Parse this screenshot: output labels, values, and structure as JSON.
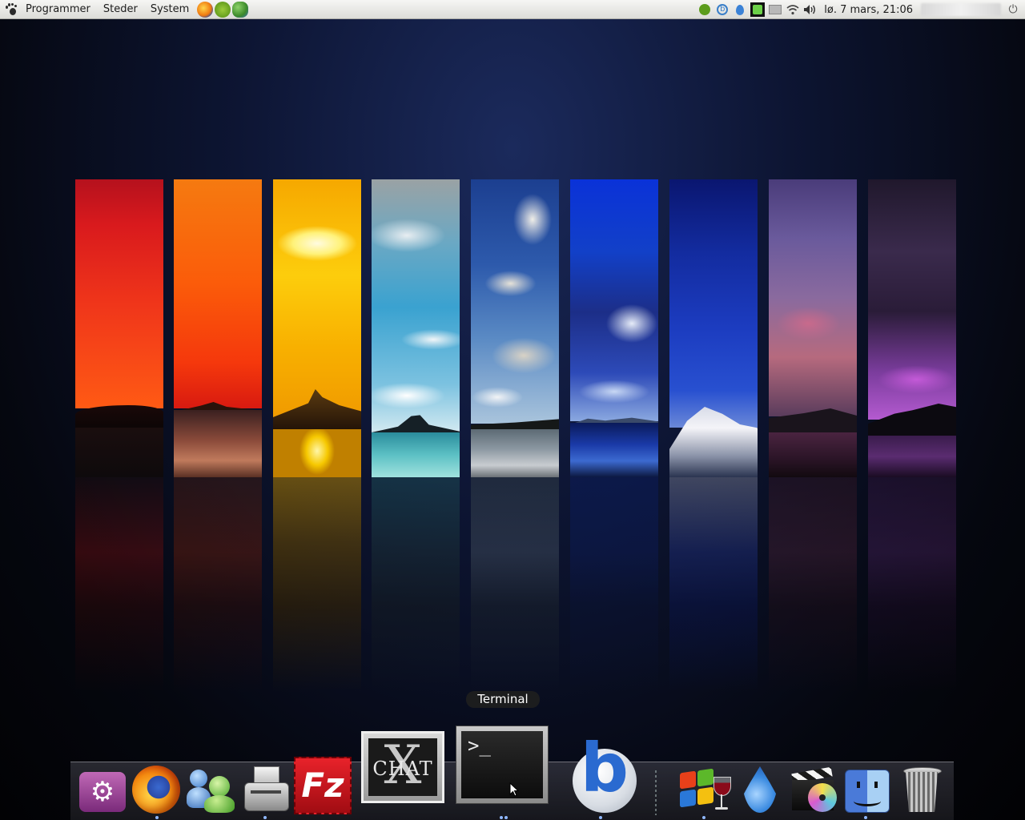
{
  "panel": {
    "menus": [
      "Programmer",
      "Steder",
      "System"
    ],
    "clock": "lø. 7 mars, 21:06",
    "launchers": [
      "firefox-icon",
      "spotify-icon",
      "pidgin-icon"
    ],
    "tray": [
      "spotify-tray-icon",
      "songbird-tray-icon",
      "drop-tray-icon",
      "chat-tray-icon",
      "printer-tray-icon",
      "wifi-icon",
      "volume-icon"
    ]
  },
  "dock": {
    "tooltip": "Terminal",
    "items": [
      {
        "name": "settings",
        "icon": "gear-icon"
      },
      {
        "name": "firefox",
        "icon": "firefox-icon"
      },
      {
        "name": "pidgin",
        "icon": "pidgin-icon"
      },
      {
        "name": "disk-utility",
        "icon": "disk-icon"
      },
      {
        "name": "filezilla",
        "icon": "filezilla-icon",
        "label": "Fz"
      },
      {
        "name": "xchat",
        "icon": "xchat-icon",
        "label": "X",
        "sublabel": "CHAT"
      },
      {
        "name": "terminal",
        "icon": "terminal-icon",
        "label": ">_"
      },
      {
        "name": "songbird",
        "icon": "songbird-icon",
        "label": "b"
      },
      {
        "name": "wine",
        "icon": "wine-icon"
      },
      {
        "name": "drop",
        "icon": "drop-icon"
      },
      {
        "name": "media",
        "icon": "media-icon"
      },
      {
        "name": "finder",
        "icon": "finder-icon"
      },
      {
        "name": "trash",
        "icon": "trash-icon"
      }
    ]
  },
  "colors": {
    "wallpaper": [
      "#e8231a",
      "#fb5a06",
      "#fdb100",
      "#5fb3d4",
      "#5f86c2",
      "#2d4ad0",
      "#1f3fa8",
      "#6d4a8a",
      "#4a2660"
    ]
  }
}
